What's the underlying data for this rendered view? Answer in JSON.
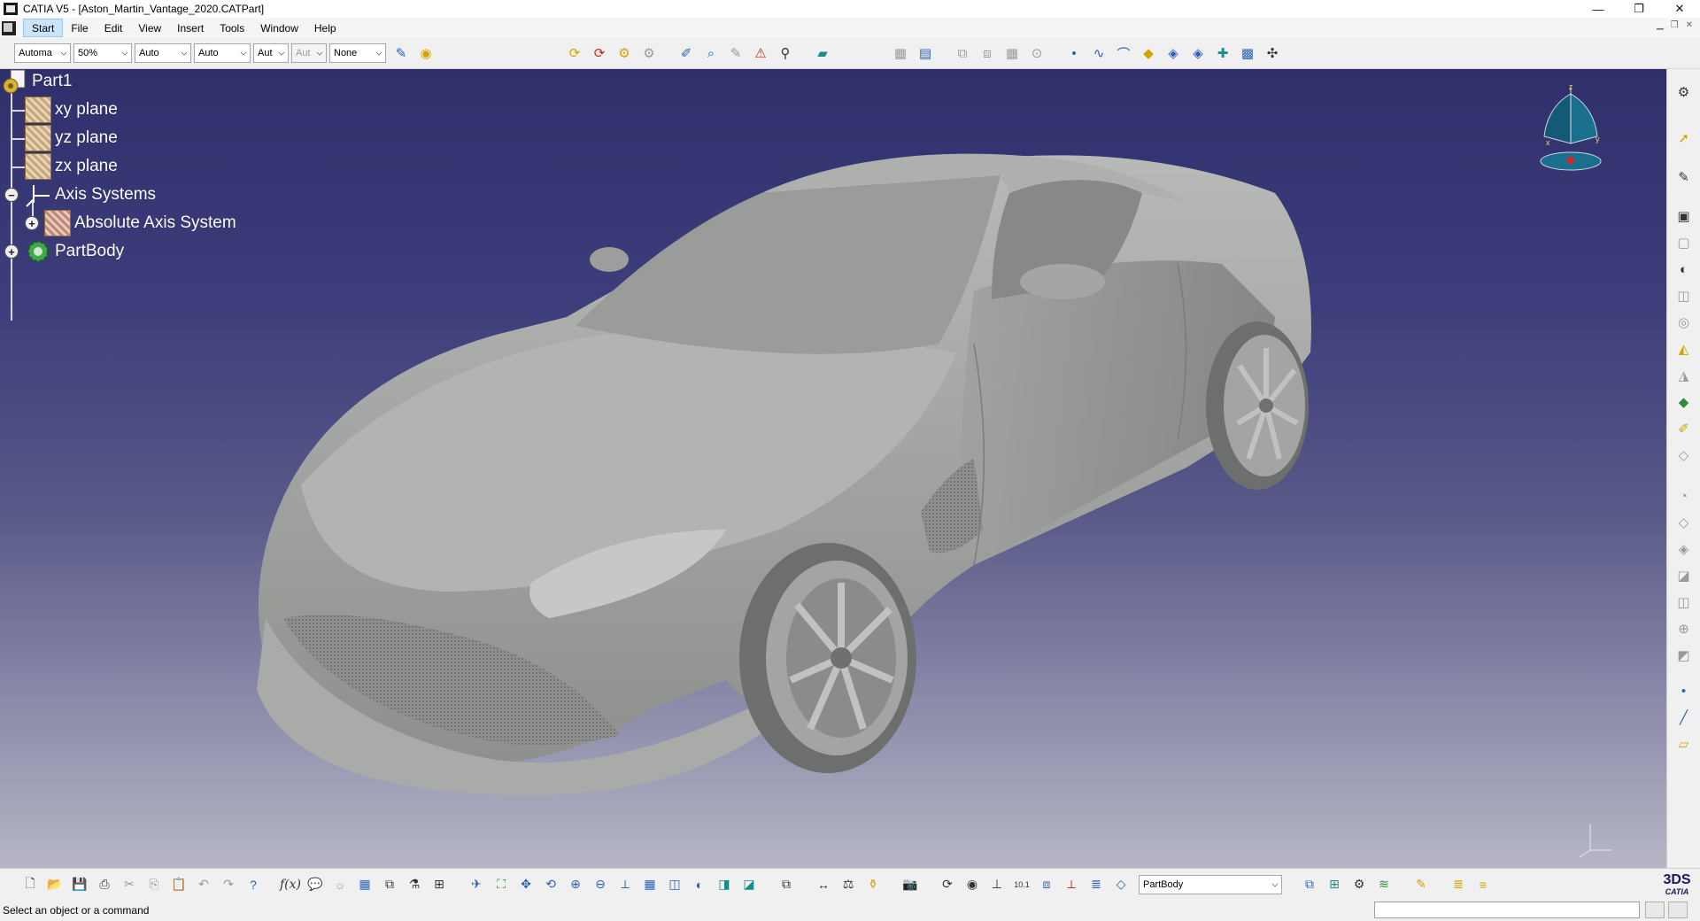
{
  "window": {
    "title": "CATIA V5 - [Aston_Martin_Vantage_2020.CATPart]",
    "controls": [
      "—",
      "❐",
      "✕"
    ]
  },
  "menu": {
    "items": [
      "Start",
      "File",
      "Edit",
      "View",
      "Insert",
      "Tools",
      "Window",
      "Help"
    ],
    "active": "Start"
  },
  "toolbar": {
    "combos": [
      {
        "value": "Automa",
        "enabled": true
      },
      {
        "value": "50%",
        "enabled": true
      },
      {
        "value": "Auto",
        "enabled": true
      },
      {
        "value": "Auto",
        "enabled": true
      },
      {
        "value": "Aut",
        "enabled": true
      },
      {
        "value": "Aut",
        "enabled": false
      },
      {
        "value": "None",
        "enabled": true
      }
    ]
  },
  "tree": {
    "root": "Part1",
    "nodes": [
      {
        "label": "xy plane"
      },
      {
        "label": "yz plane"
      },
      {
        "label": "zx plane"
      },
      {
        "label": "Axis Systems"
      },
      {
        "label": "Absolute Axis System"
      },
      {
        "label": "PartBody"
      }
    ]
  },
  "compass": {
    "labels": [
      "z",
      "x",
      "y"
    ]
  },
  "bottom_toolbar": {
    "current_body": "PartBody"
  },
  "logo": {
    "text": "CATIA"
  },
  "status": {
    "message": "Select an object or a command"
  },
  "colors": {
    "viewport_top": "#2f2f6c",
    "viewport_bottom": "#b6b6c6",
    "model": "#a8aaa8"
  }
}
